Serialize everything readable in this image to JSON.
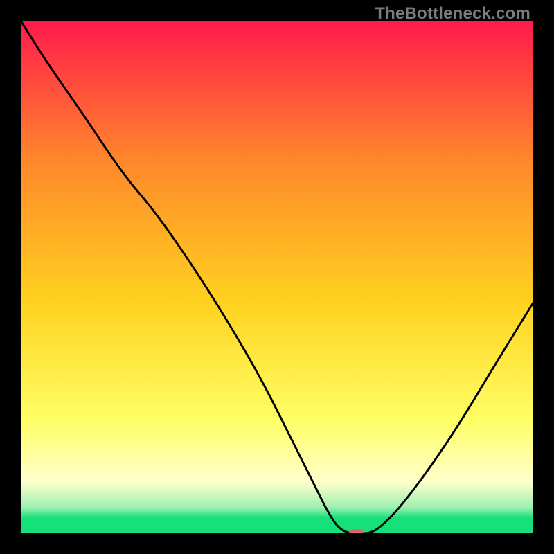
{
  "watermark": "TheBottleneck.com",
  "colors": {
    "top": "#ff1a4b",
    "mid1": "#ff8a2a",
    "mid2": "#ffd21f",
    "mid3": "#ffff66",
    "pale": "#ffffcc",
    "green_light": "#9df0b0",
    "green": "#15e07a",
    "curve": "#000000",
    "marker": "#d46a6a",
    "frame": "#000000"
  },
  "chart_data": {
    "type": "line",
    "title": "",
    "xlabel": "",
    "ylabel": "",
    "xlim": [
      0,
      100
    ],
    "ylim": [
      0,
      100
    ],
    "series": [
      {
        "name": "bottleneck-curve",
        "x": [
          0,
          5,
          12,
          20,
          26,
          33,
          40,
          47,
          53,
          58,
          60,
          62,
          64,
          66,
          68,
          70,
          74,
          80,
          86,
          92,
          100
        ],
        "y": [
          100,
          92,
          82,
          70,
          63,
          53,
          42,
          30,
          18,
          8,
          4,
          1,
          0,
          0,
          0,
          1,
          5,
          13,
          22,
          32,
          45
        ]
      }
    ],
    "marker": {
      "x": 65.5,
      "y": 0
    },
    "gradient_stops": [
      {
        "pct": 0,
        "value": 100
      },
      {
        "pct": 50,
        "value": 50
      },
      {
        "pct": 92,
        "value": 8
      },
      {
        "pct": 100,
        "value": 0
      }
    ]
  }
}
